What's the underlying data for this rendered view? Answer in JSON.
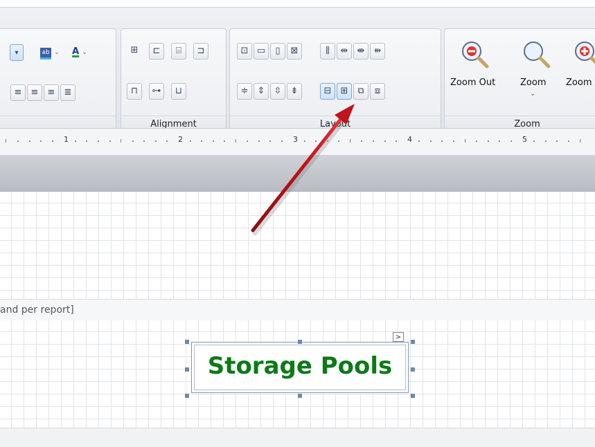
{
  "ribbon": {
    "groups": {
      "font": {
        "label": ""
      },
      "alignment": {
        "label": "Alignment"
      },
      "layout": {
        "label": "Layout"
      },
      "zoom": {
        "label": "Zoom",
        "zoom_out_label": "Zoom Out",
        "zoom_label": "Zoom",
        "zoom_in_label": "Zoom"
      }
    }
  },
  "ruler": {
    "marks": [
      "1",
      "2",
      "3",
      "4",
      "5"
    ]
  },
  "band": {
    "caption": "and per report]"
  },
  "label": {
    "text": "Storage Pools",
    "color": "#0c7a17"
  },
  "accent": {
    "selection": "#6f87aa",
    "arrow": "#c0141a"
  },
  "icons": [
    "dropdown-icon",
    "text-highlight-icon",
    "font-color-icon",
    "align-left-icon",
    "align-center-icon",
    "align-right-icon",
    "justify-icon",
    "zoom-out-icon",
    "zoom-icon",
    "zoom-in-icon",
    "smart-tag-icon"
  ]
}
